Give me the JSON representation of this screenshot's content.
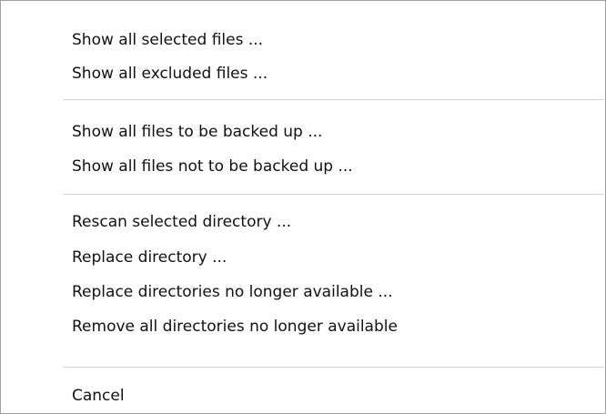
{
  "menu": {
    "items": [
      {
        "label": "Show all selected files ..."
      },
      {
        "label": "Show all excluded files ..."
      },
      {
        "label": "Show all files to be backed up ..."
      },
      {
        "label": "Show all files not to be backed up ..."
      },
      {
        "label": "Rescan selected directory ..."
      },
      {
        "label": "Replace directory ..."
      },
      {
        "label": "Replace directories no longer available ..."
      },
      {
        "label": "Remove all directories no longer available"
      },
      {
        "label": "Cancel"
      }
    ]
  }
}
